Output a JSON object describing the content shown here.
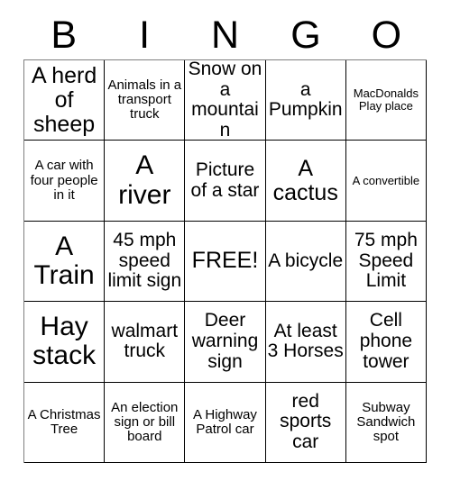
{
  "card": {
    "header_letters": [
      "B",
      "I",
      "N",
      "G",
      "O"
    ],
    "rows": [
      [
        {
          "text": "A herd of sheep",
          "size": "lg"
        },
        {
          "text": "Animals in a transport truck",
          "size": "sm"
        },
        {
          "text": "Snow on a mountain",
          "size": "md"
        },
        {
          "text": "a Pumpkin",
          "size": "md"
        },
        {
          "text": "MacDonalds Play place",
          "size": "xs"
        }
      ],
      [
        {
          "text": "A car with four people in it",
          "size": "sm"
        },
        {
          "text": "A river",
          "size": "xl"
        },
        {
          "text": "Picture of a star",
          "size": "md"
        },
        {
          "text": "A cactus",
          "size": "lg"
        },
        {
          "text": "A convertible",
          "size": "xs"
        }
      ],
      [
        {
          "text": "A Train",
          "size": "xl"
        },
        {
          "text": "45 mph speed limit sign",
          "size": "md"
        },
        {
          "text": "FREE!",
          "size": "lg"
        },
        {
          "text": "A bicycle",
          "size": "md"
        },
        {
          "text": "75 mph Speed Limit",
          "size": "md"
        }
      ],
      [
        {
          "text": "Hay stack",
          "size": "xl"
        },
        {
          "text": "walmart truck",
          "size": "md"
        },
        {
          "text": "Deer warning sign",
          "size": "md"
        },
        {
          "text": "At least 3 Horses",
          "size": "md"
        },
        {
          "text": "Cell phone tower",
          "size": "md"
        }
      ],
      [
        {
          "text": "A Christmas Tree",
          "size": "sm"
        },
        {
          "text": "An election sign or bill board",
          "size": "sm"
        },
        {
          "text": "A Highway Patrol car",
          "size": "sm"
        },
        {
          "text": "red sports car",
          "size": "md"
        },
        {
          "text": "Subway Sandwich spot",
          "size": "sm"
        }
      ]
    ]
  },
  "colors": {
    "background": "#ffffff",
    "text": "#000000",
    "grid_line": "#000000"
  }
}
